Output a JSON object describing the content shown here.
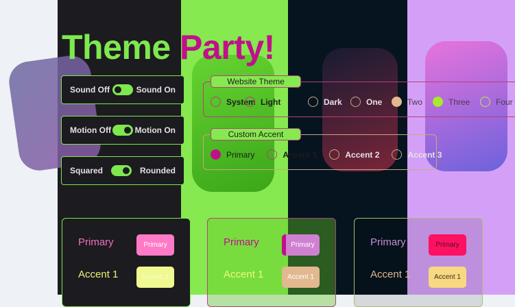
{
  "title": "Theme Party!",
  "colors": {
    "primary": "#c0108a",
    "accent": "#7ee84f",
    "surface": "#1c1b1f"
  },
  "toggles": [
    {
      "off": "Sound Off",
      "on": "Sound On",
      "state": "off"
    },
    {
      "off": "Motion Off",
      "on": "Motion On",
      "state": "on"
    },
    {
      "off": "Squared",
      "on": "Rounded",
      "state": "on"
    }
  ],
  "website_theme": {
    "legend": "Website Theme",
    "options": [
      "System",
      "Light",
      "Dark",
      "One",
      "Two",
      "Three",
      "Four"
    ],
    "selected": "Three"
  },
  "custom_accent": {
    "legend": "Custom Accent",
    "options": [
      "Primary",
      "Accent 1",
      "Accent 2",
      "Accent 3"
    ],
    "selected": "Primary"
  },
  "cards": [
    {
      "primary_label": "Primary",
      "primary_button": "Primary",
      "accent_label": "Accent 1",
      "accent_button": "Accent 1"
    },
    {
      "primary_label": "Primary",
      "primary_button": "Primary",
      "accent_label": "Accent 1",
      "accent_button": "Accent 1"
    },
    {
      "primary_label": "Primary",
      "primary_button": "Primary",
      "accent_label": "Accent 1",
      "accent_button": "Accent 1"
    }
  ]
}
